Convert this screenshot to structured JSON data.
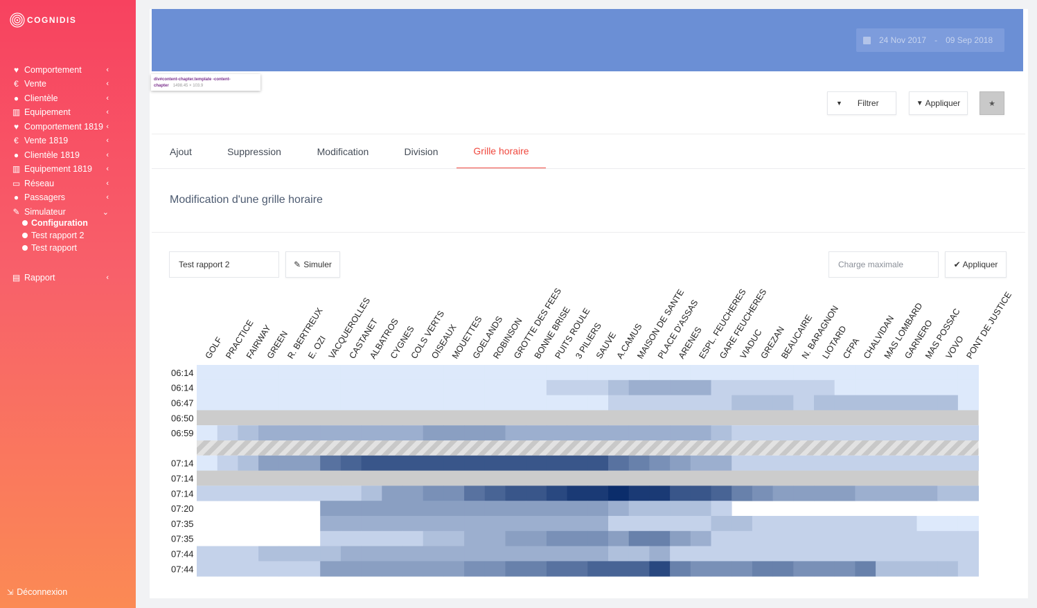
{
  "app": {
    "name": "COGNIDIS"
  },
  "sidebar": {
    "items": [
      {
        "label": "Comportement",
        "icon": "heart-icon"
      },
      {
        "label": "Vente",
        "icon": "euro-icon"
      },
      {
        "label": "Clientèle",
        "icon": "user-icon"
      },
      {
        "label": "Equipement",
        "icon": "bank-icon"
      },
      {
        "label": "Comportement 1819",
        "icon": "heart-icon"
      },
      {
        "label": "Vente 1819",
        "icon": "euro-icon"
      },
      {
        "label": "Clientèle 1819",
        "icon": "user-icon"
      },
      {
        "label": "Equipement 1819",
        "icon": "bank-icon"
      },
      {
        "label": "Réseau",
        "icon": "bus-icon"
      },
      {
        "label": "Passagers",
        "icon": "user-icon"
      },
      {
        "label": "Simulateur",
        "icon": "magic-wand-icon",
        "expanded": true
      },
      {
        "label": "Rapport",
        "icon": "archive-icon"
      }
    ],
    "subitems": [
      {
        "label": "Configuration",
        "active": true
      },
      {
        "label": "Test rapport 2",
        "active": false
      },
      {
        "label": "Test rapport",
        "active": false
      }
    ],
    "logout": "Déconnexion"
  },
  "header": {
    "date_from": "24 Nov 2017",
    "date_sep": "-",
    "date_to": "09 Sep 2018",
    "devtools_tooltip": {
      "selector": "div#content-chapter.template -content-chapter",
      "size": "1498.45 × 103.9"
    }
  },
  "toolbar": {
    "filter_label": "Filtrer",
    "apply_label": "Appliquer"
  },
  "tabs": [
    {
      "label": "Ajout",
      "active": false
    },
    {
      "label": "Suppression",
      "active": false
    },
    {
      "label": "Modification",
      "active": false
    },
    {
      "label": "Division",
      "active": false
    },
    {
      "label": "Grille horaire",
      "active": true
    }
  ],
  "section": {
    "title": "Modification d'une grille horaire",
    "report_value": "Test rapport 2",
    "simulate_label": "Simuler",
    "charge_placeholder": "Charge maximale",
    "apply_label": "Appliquer"
  },
  "colors": {
    "accent": "#f0483e",
    "banner": "#6b8fd5",
    "cancelled_row": "#cccccc",
    "heat_low": "#dde9fb",
    "heat_high": "#0b2d6b"
  },
  "chart_data": {
    "type": "heatmap",
    "stops": [
      "GOLF",
      "PRACTICE",
      "FAIRWAY",
      "GREEN",
      "R. BERTREUX",
      "E. OZI",
      "VACQUEROLLES",
      "CASTANET",
      "ALBATROS",
      "CYGNES",
      "COLS VERTS",
      "OISEAUX",
      "MOUETTES",
      "GOELANDS",
      "ROBINSON",
      "GROTTE DES FEES",
      "BONNE BRISE",
      "PUITS ROULE",
      "3 PILIERS",
      "SAUVE",
      "A.CAMUS",
      "MAISON DE SANTE",
      "PLACE D'ASSAS",
      "ARENES",
      "ESPL. FEUCHERES",
      "GARE FEUCHERES",
      "VIADUC",
      "GREZAN",
      "BEAUCAIRE",
      "N. BARAGNON",
      "LIOTARD",
      "CFPA",
      "CHALVIDAN",
      "MAS LOMBARD",
      "GARNERO",
      "MAS POSSAC",
      "VOVO",
      "PONT DE JUSTICE"
    ],
    "rows": [
      {
        "time": "06:14",
        "state": "normal",
        "values": [
          0,
          0,
          0,
          0,
          0,
          0,
          0,
          0,
          0,
          0,
          0,
          0,
          0,
          0,
          0,
          0,
          0,
          0,
          0,
          0,
          0,
          0,
          0,
          0,
          0,
          0,
          0,
          0,
          0,
          0,
          0,
          0,
          0,
          0,
          0,
          0,
          0,
          0
        ]
      },
      {
        "time": "06:14",
        "state": "normal",
        "values": [
          0,
          0,
          0,
          0,
          0,
          0,
          0,
          0,
          0,
          0,
          0,
          0,
          0,
          0,
          0,
          0,
          0,
          1,
          1,
          1,
          2,
          3,
          3,
          3,
          3,
          1,
          1,
          1,
          1,
          1,
          1,
          0,
          0,
          0,
          0,
          0,
          0,
          0
        ]
      },
      {
        "time": "06:47",
        "state": "normal",
        "values": [
          0,
          0,
          0,
          0,
          0,
          0,
          0,
          0,
          0,
          0,
          0,
          0,
          0,
          0,
          0,
          0,
          0,
          0,
          0,
          0,
          1,
          1,
          1,
          1,
          1,
          1,
          2,
          2,
          2,
          1,
          2,
          2,
          2,
          2,
          2,
          2,
          2,
          0
        ]
      },
      {
        "time": "06:50",
        "state": "cancelled",
        "values": []
      },
      {
        "time": "06:59",
        "state": "normal",
        "values": [
          0,
          1,
          2,
          3,
          3,
          3,
          3,
          3,
          3,
          3,
          3,
          4,
          4,
          4,
          4,
          3,
          3,
          3,
          3,
          3,
          3,
          3,
          3,
          3,
          3,
          2,
          1,
          1,
          1,
          1,
          1,
          1,
          1,
          1,
          1,
          1,
          1,
          1
        ]
      },
      {
        "time": "",
        "state": "hatched",
        "values": []
      },
      {
        "time": "07:14",
        "state": "normal",
        "values": [
          0,
          1,
          2,
          4,
          4,
          4,
          7,
          8,
          9,
          9,
          9,
          9,
          9,
          9,
          9,
          9,
          9,
          9,
          9,
          9,
          7,
          6,
          5,
          4,
          3,
          3,
          1,
          1,
          1,
          1,
          1,
          1,
          1,
          1,
          1,
          1,
          1,
          1
        ]
      },
      {
        "time": "07:14",
        "state": "cancelled",
        "values": []
      },
      {
        "time": "07:14",
        "state": "normal",
        "values": [
          1,
          1,
          1,
          1,
          1,
          1,
          1,
          1,
          2,
          4,
          4,
          5,
          5,
          7,
          8,
          9,
          9,
          10,
          11,
          11,
          12,
          11,
          11,
          9,
          9,
          8,
          6,
          5,
          4,
          4,
          4,
          4,
          3,
          3,
          3,
          3,
          2,
          2
        ]
      },
      {
        "time": "07:20",
        "state": "partial",
        "values": [
          null,
          null,
          null,
          null,
          null,
          null,
          4,
          4,
          4,
          4,
          4,
          4,
          4,
          4,
          4,
          4,
          4,
          4,
          4,
          4,
          3,
          2,
          2,
          2,
          2,
          1,
          null,
          null,
          null,
          null,
          null,
          null,
          null,
          null,
          null,
          null,
          null,
          null
        ]
      },
      {
        "time": "07:35",
        "state": "partial",
        "values": [
          null,
          null,
          null,
          null,
          null,
          null,
          3,
          3,
          3,
          3,
          3,
          3,
          3,
          3,
          3,
          3,
          3,
          3,
          3,
          3,
          1,
          1,
          1,
          1,
          1,
          2,
          2,
          1,
          1,
          1,
          1,
          1,
          1,
          1,
          1,
          0,
          0,
          0
        ]
      },
      {
        "time": "07:35",
        "state": "partial",
        "values": [
          null,
          null,
          null,
          null,
          null,
          null,
          1,
          1,
          1,
          1,
          1,
          2,
          2,
          3,
          3,
          4,
          4,
          5,
          5,
          5,
          4,
          6,
          6,
          4,
          3,
          1,
          1,
          1,
          1,
          1,
          1,
          1,
          1,
          1,
          1,
          1,
          1,
          1
        ]
      },
      {
        "time": "07:44",
        "state": "normal",
        "values": [
          1,
          1,
          1,
          2,
          2,
          2,
          2,
          3,
          3,
          3,
          3,
          3,
          3,
          3,
          3,
          3,
          3,
          3,
          3,
          3,
          2,
          2,
          3,
          1,
          1,
          1,
          1,
          1,
          1,
          1,
          1,
          1,
          1,
          1,
          1,
          1,
          1,
          1
        ]
      },
      {
        "time": "07:44",
        "state": "normal",
        "values": [
          1,
          1,
          1,
          1,
          1,
          1,
          4,
          4,
          4,
          4,
          4,
          4,
          4,
          5,
          5,
          6,
          6,
          7,
          7,
          8,
          8,
          8,
          10,
          6,
          5,
          5,
          5,
          6,
          6,
          5,
          5,
          5,
          6,
          2,
          2,
          2,
          2,
          1
        ]
      }
    ],
    "value_range": [
      0,
      12
    ]
  }
}
